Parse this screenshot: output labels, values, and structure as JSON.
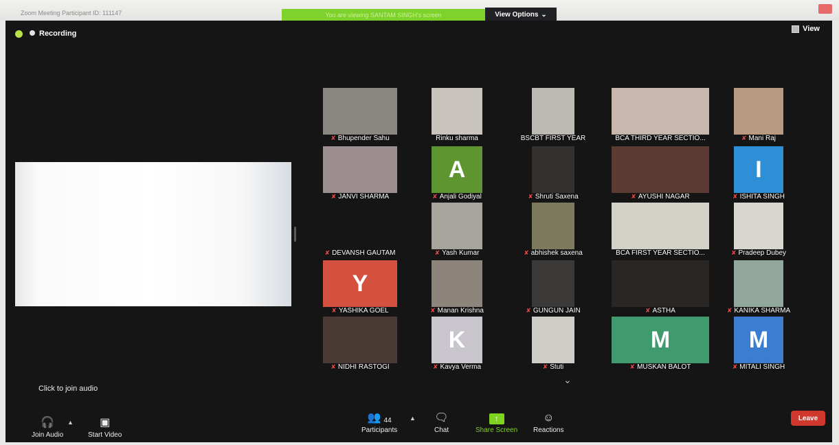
{
  "window": {
    "title": "Zoom Meeting Participant ID: 111147",
    "share_banner": "You are viewing SANTAM SINGH's screen"
  },
  "view_options": {
    "label": "View Options",
    "caret": "⌄"
  },
  "top": {
    "recording_label": "Recording",
    "view_label": "View"
  },
  "participants": [
    {
      "name": "Bhupender Sahu",
      "muted": true,
      "video": "#8a8680"
    },
    {
      "name": "Rinku sharma",
      "muted": false,
      "video": "#c9c4bd"
    },
    {
      "name": "BSCBT FIRST YEAR",
      "muted": false,
      "video": "#bdbab4"
    },
    {
      "name": "BCA THIRD YEAR SECTIO...",
      "muted": false,
      "video": "#c7b7ad"
    },
    {
      "name": "Mani Raj",
      "muted": true,
      "video": "#b89a82"
    },
    {
      "name": "JANVI SHARMA",
      "muted": true,
      "video": "#9c8e8e"
    },
    {
      "name": "Anjali Godiyal",
      "muted": true,
      "letter": "A",
      "color": "#5e9531"
    },
    {
      "name": "Shruti Saxena",
      "muted": true,
      "video": "#33302e"
    },
    {
      "name": "AYUSHI NAGAR",
      "muted": true,
      "video": "#5b3a34"
    },
    {
      "name": "ISHITA SINGH",
      "muted": true,
      "letter": "I",
      "color": "#2f8fd6"
    },
    {
      "name": "DEVANSH GAUTAM",
      "muted": true,
      "video": "#151515"
    },
    {
      "name": "Yash Kumar",
      "muted": true,
      "video": "#a7a49d"
    },
    {
      "name": "abhishek saxena",
      "muted": true,
      "video": "#7e7a5e"
    },
    {
      "name": "BCA FIRST YEAR SECTIO...",
      "muted": false,
      "video": "#d4d2c8"
    },
    {
      "name": "Pradeep Dubey",
      "muted": true,
      "video": "#d9d6cf"
    },
    {
      "name": "YASHIKA GOEL",
      "muted": true,
      "letter": "Y",
      "color": "#d4503f"
    },
    {
      "name": "Manan Krishna",
      "muted": true,
      "video": "#8d857c"
    },
    {
      "name": "GUNGUN JAIN",
      "muted": true,
      "video": "#3c3a38"
    },
    {
      "name": "ASTHA",
      "muted": true,
      "video": "#2a2624"
    },
    {
      "name": "KANIKA SHARMA",
      "muted": true,
      "video": "#93a89c"
    },
    {
      "name": "NIDHI RASTOGI",
      "muted": true,
      "video": "#4a3a36"
    },
    {
      "name": "Kavya Verma",
      "muted": true,
      "letter": "K",
      "color": "#c9c5cc"
    },
    {
      "name": "Stuti",
      "muted": true,
      "video": "#cfcdc8"
    },
    {
      "name": "MUSKAN BALOT",
      "muted": true,
      "letter": "M",
      "color": "#3f9a6d"
    },
    {
      "name": "MITALI SINGH",
      "muted": true,
      "letter": "M",
      "color": "#3a7dd1"
    }
  ],
  "audio": {
    "click_to_join": "Click to join audio"
  },
  "toolbar": {
    "join_audio": "Join Audio",
    "start_video": "Start Video",
    "participants": "Participants",
    "participants_count": "44",
    "chat": "Chat",
    "share_screen": "Share Screen",
    "reactions": "Reactions",
    "leave": "Leave"
  },
  "colors": {
    "share_green": "#7ed321",
    "leave_red": "#d0382e",
    "shield_green": "#b7e04b"
  }
}
